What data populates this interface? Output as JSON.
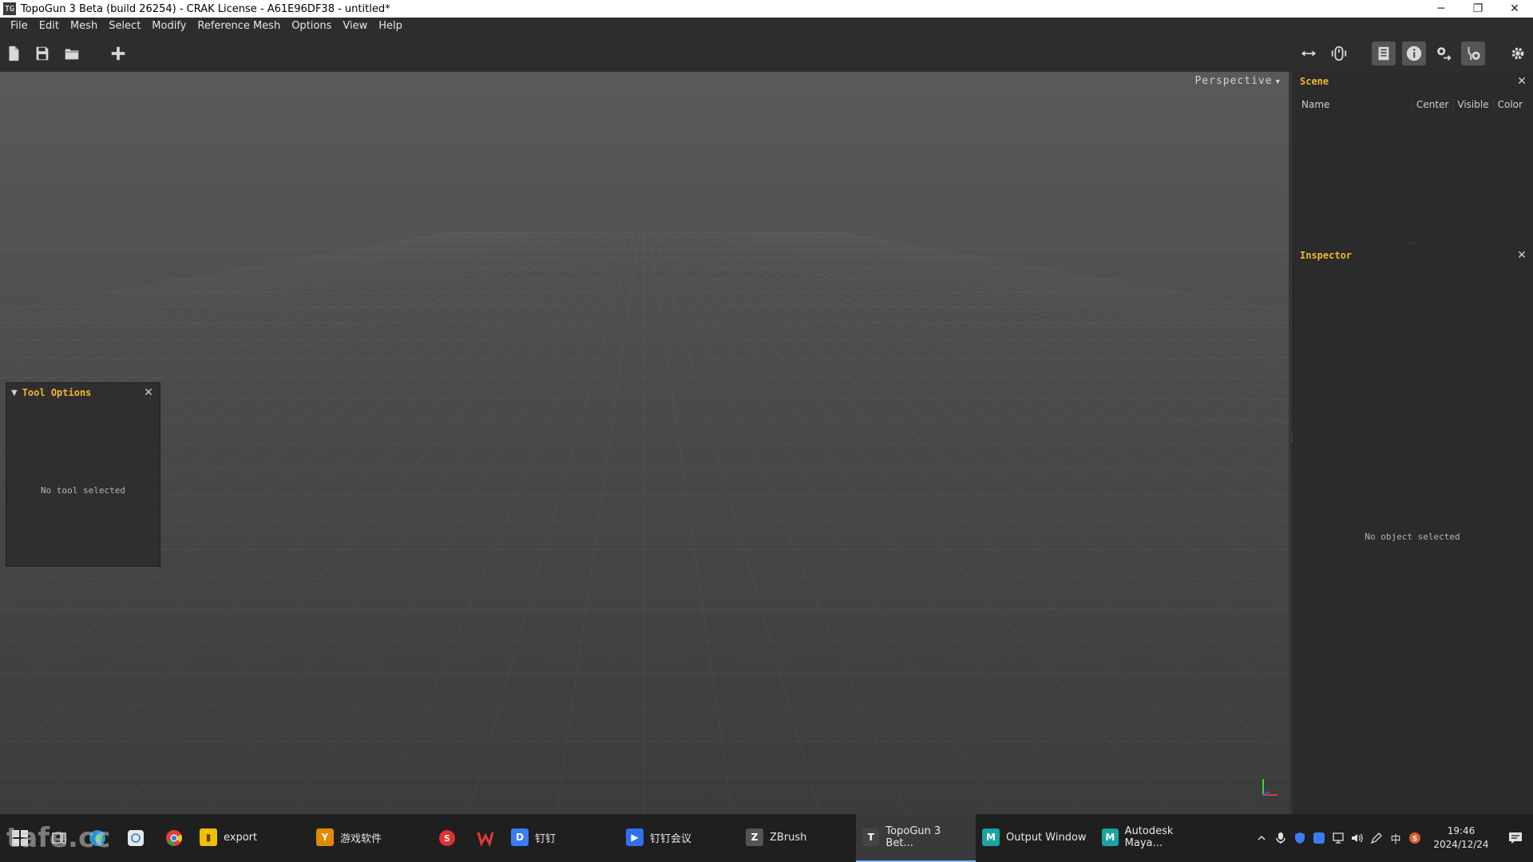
{
  "window": {
    "title": "TopoGun 3 Beta (build 26254) - CRAK License - A61E96DF38 - untitled*",
    "minimize_label": "─",
    "restore_label": "❐",
    "close_label": "✕"
  },
  "menu": {
    "items": [
      "File",
      "Edit",
      "Mesh",
      "Select",
      "Modify",
      "Reference Mesh",
      "Options",
      "View",
      "Help"
    ]
  },
  "toolbar": {
    "left_icons": [
      "new-file-icon",
      "save-icon",
      "open-folder-icon",
      "add-icon"
    ],
    "right_icons": [
      "move-arrows-icon",
      "mouse-icon",
      "list-icon",
      "info-icon",
      "settings-transfer-icon",
      "settings-tool-icon",
      "gear-icon"
    ]
  },
  "viewport": {
    "camera_label": "Perspective",
    "camera_arrow": "▼"
  },
  "tool_options": {
    "title": "Tool Options",
    "empty_message": "No tool selected",
    "close_label": "✕",
    "collapse_label": "▼"
  },
  "scene": {
    "title": "Scene",
    "close_label": "✕",
    "columns": [
      "Name",
      "Center",
      "Visible",
      "Color"
    ]
  },
  "inspector": {
    "title": "Inspector",
    "close_label": "✕",
    "empty_message": "No object selected"
  },
  "taskbar": {
    "watermark": "tafe.cc",
    "apps": [
      {
        "label": "export",
        "badge": "▮",
        "color": "#f0c000",
        "active": false
      },
      {
        "label": "游戏软件",
        "badge": "Y",
        "color": "#e08a00",
        "active": false
      },
      {
        "label": "钉钉",
        "badge": "D",
        "color": "#3b7cf5",
        "active": false
      },
      {
        "label": "钉钉会议",
        "badge": "▶",
        "color": "#2f6ff0",
        "active": false
      },
      {
        "label": "ZBrush",
        "badge": "Z",
        "color": "#555555",
        "active": false
      },
      {
        "label": "TopoGun 3 Bet...",
        "badge": "T",
        "color": "#444444",
        "active": true
      },
      {
        "label": "Output Window",
        "badge": "M",
        "color": "#1aa3a3",
        "active": false
      },
      {
        "label": "Autodesk Maya...",
        "badge": "M",
        "color": "#1aa3a3",
        "active": false
      }
    ],
    "ime_label": "中",
    "time": "19:46",
    "date": "2024/12/24"
  }
}
